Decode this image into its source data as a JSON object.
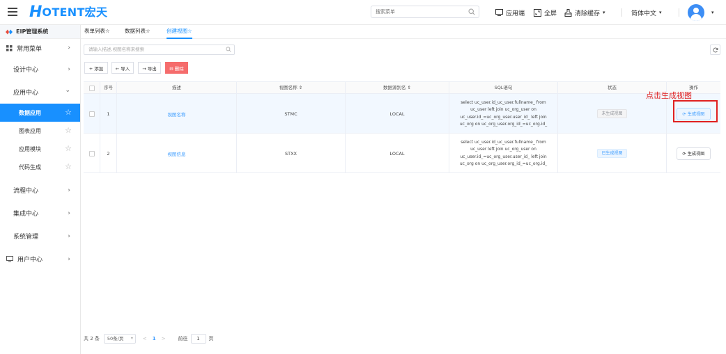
{
  "header": {
    "logo_h": "H",
    "logo_text": "OTENT宏天",
    "search_placeholder": "搜索菜单",
    "app_end_label": "应用端",
    "fullscreen_label": "全屏",
    "clear_cache_label": "清除缓存",
    "language_label": "简体中文",
    "dropdown_caret": "▾"
  },
  "sidebar": {
    "system_title": "EIP管理系统",
    "common_menu_label": "常用菜单",
    "items": [
      {
        "label": "设计中心"
      },
      {
        "label": "应用中心"
      },
      {
        "label": "流程中心"
      },
      {
        "label": "集成中心"
      },
      {
        "label": "系统管理"
      },
      {
        "label": "用户中心"
      }
    ],
    "sub_items": [
      {
        "label": "数据应用",
        "active": true
      },
      {
        "label": "图表应用"
      },
      {
        "label": "应用模块"
      },
      {
        "label": "代码生成"
      }
    ],
    "arrow_right": "›",
    "arrow_down": "⌄",
    "star": "☆"
  },
  "tabs": [
    {
      "label": "表单列表☆"
    },
    {
      "label": "数据列表☆"
    },
    {
      "label": "创建视图☆",
      "active": true
    }
  ],
  "toolbar": {
    "filter_placeholder": "请输入描述,视图名称来搜索",
    "add_label": "+ 添加",
    "import_label": "← 导入",
    "export_label": "→ 导出",
    "delete_label": "⊟ 删除"
  },
  "table": {
    "columns": [
      "",
      "序号",
      "描述",
      "视图名称 ⇕",
      "数据源别名 ⇕",
      "SQL语句",
      "状态",
      "操作"
    ],
    "rows": [
      {
        "index": "1",
        "description": "视图名称",
        "view_name": "STMC",
        "datasource": "LOCAL",
        "sql": "select uc_user.id_uc_user.fullname_ from uc_user left join uc_org_user on uc_user.id_=uc_org_user.user_id_ left join uc_org on uc_org_user.org_id_=uc_org.id_",
        "status": "未生成视图",
        "action": "⟳ 生成视图"
      },
      {
        "index": "2",
        "description": "视图信息",
        "view_name": "STXX",
        "datasource": "LOCAL",
        "sql": "select uc_user.id_uc_user.fullname_ from uc_user left join uc_org_user on uc_user.id_=uc_org_user.user_id_ left join uc_org on uc_org_user.org_id_=uc_org.id_",
        "status": "已生成视图",
        "action": "⟳ 生成视图"
      }
    ]
  },
  "annotation": "点击生成视图",
  "pagination": {
    "total": "共 2 条",
    "page_size": "50条/页",
    "prev": "<",
    "current": "1",
    "next": ">",
    "goto_label": "前往",
    "goto_value": "1",
    "page_label": "页"
  },
  "colors": {
    "accent": "#1890ff",
    "danger": "#f56c6c",
    "annotation": "#e02020"
  }
}
